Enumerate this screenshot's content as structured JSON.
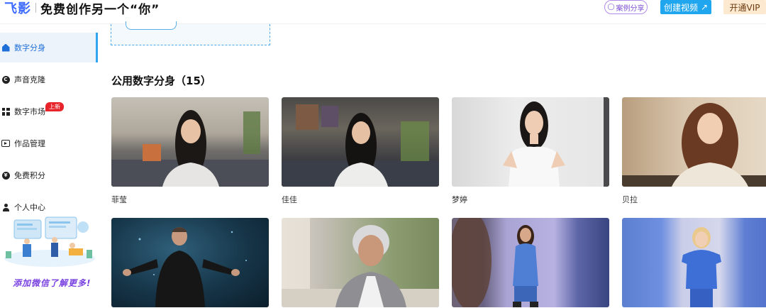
{
  "header": {
    "logo": "飞影",
    "slogan": "免费创作另一个“你”",
    "case_share": "案例分享",
    "create_video": "创建视频",
    "create_video_icon": "arrow-up-right-icon",
    "vip": "开通VIP"
  },
  "sidebar": {
    "items": [
      {
        "label": "数字分身",
        "icon": "home-icon",
        "active": true
      },
      {
        "label": "声音克隆",
        "icon": "copyright-circle-icon"
      },
      {
        "label": "数字市场",
        "icon": "grid-icon",
        "badge": "上新"
      },
      {
        "label": "作品管理",
        "icon": "play-icon"
      },
      {
        "label": "免费积分",
        "icon": "yen-circle-icon"
      },
      {
        "label": "个人中心",
        "icon": "user-icon"
      }
    ],
    "promo_text": "添加微信了解更多!"
  },
  "main": {
    "section_title": "公用数字分身（15）",
    "cards": [
      {
        "name": "菲莹"
      },
      {
        "name": "佳佳"
      },
      {
        "name": "梦婷"
      },
      {
        "name": "贝拉"
      },
      {
        "name": ""
      },
      {
        "name": ""
      },
      {
        "name": ""
      },
      {
        "name": ""
      }
    ]
  },
  "colors": {
    "accent": "#20a6ee",
    "active_text": "#1e6fd8",
    "badge": "#e8242b",
    "vip_bg": "#fde9cf",
    "promo": "#7a42e0"
  }
}
